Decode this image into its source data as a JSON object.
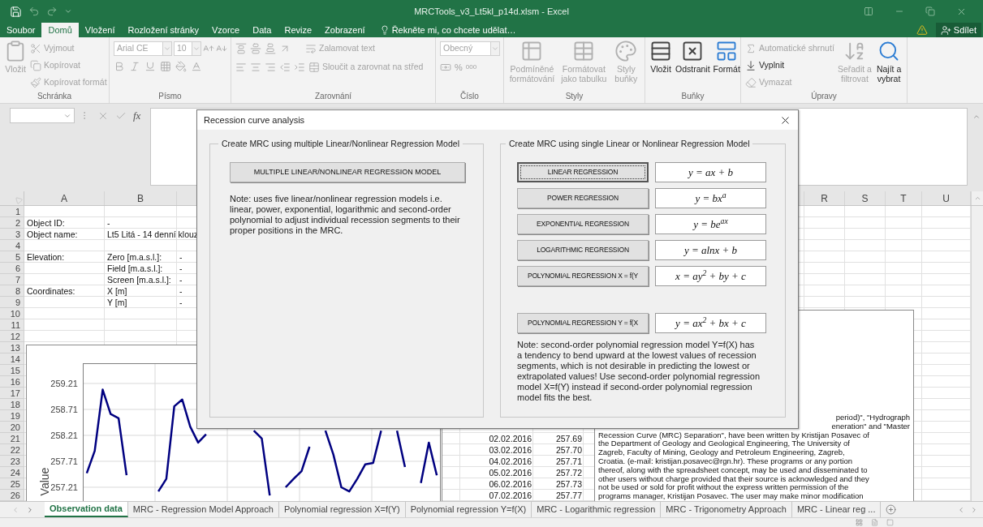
{
  "window": {
    "title": "MRCTools_v3_Lt5kl_p14d.xlsm - Excel"
  },
  "menu_tabs": [
    {
      "label": "Soubor",
      "selected": false
    },
    {
      "label": "Domů",
      "selected": true
    },
    {
      "label": "Vložení",
      "selected": false
    },
    {
      "label": "Rozložení stránky",
      "selected": false
    },
    {
      "label": "Vzorce",
      "selected": false
    },
    {
      "label": "Data",
      "selected": false
    },
    {
      "label": "Revize",
      "selected": false
    },
    {
      "label": "Zobrazení",
      "selected": false
    }
  ],
  "tell_me": {
    "placeholder": "Řekněte mi, co chcete udělat…"
  },
  "share_button": "Sdílet",
  "ribbon_groups": [
    {
      "kind": "clipboard",
      "label": "Schránka",
      "items": [
        {
          "kind": "large",
          "label": "Vložit",
          "disabled": true
        },
        {
          "kind": "small",
          "label": "Vyjmout",
          "disabled": true
        },
        {
          "kind": "small",
          "label": "Kopírovat",
          "disabled": true
        },
        {
          "kind": "small",
          "label": "Kopírovat formát",
          "disabled": true
        }
      ]
    },
    {
      "kind": "font",
      "label": "Písmo",
      "items": [
        {
          "kind": "combo",
          "label": "Arial CE",
          "disabled": true
        },
        {
          "kind": "combo",
          "label": "10",
          "disabled": true
        }
      ]
    },
    {
      "kind": "alignment",
      "label": "Zarovnání",
      "items": [
        {
          "kind": "small",
          "label": "Zalamovat text",
          "disabled": true
        },
        {
          "kind": "small",
          "label": "Sloučit a zarovnat na střed",
          "disabled": true
        }
      ]
    },
    {
      "kind": "number",
      "label": "Číslo",
      "items": [
        {
          "kind": "combo",
          "label": "Obecný",
          "disabled": true
        },
        {
          "kind": "glyph",
          "label": "%",
          "disabled": true
        },
        {
          "kind": "glyph",
          "label": "000",
          "disabled": true
        }
      ]
    },
    {
      "kind": "styles",
      "label": "Styly",
      "items": [
        {
          "kind": "large",
          "label": "Podmíněné formátování",
          "disabled": true
        },
        {
          "kind": "large",
          "label": "Formátovat jako tabulku",
          "disabled": true
        },
        {
          "kind": "large",
          "label": "Styly buňky",
          "disabled": true
        }
      ]
    },
    {
      "kind": "cells",
      "label": "Buňky",
      "items": [
        {
          "kind": "large",
          "label": "Vložit",
          "disabled": false
        },
        {
          "kind": "large",
          "label": "Odstranit",
          "disabled": false
        },
        {
          "kind": "large",
          "label": "Formát",
          "disabled": false
        }
      ]
    },
    {
      "kind": "editing",
      "label": "Úpravy",
      "items": [
        {
          "kind": "small",
          "label": "Automatické shrnutí",
          "disabled": true
        },
        {
          "kind": "small",
          "label": "Vyplnit",
          "disabled": false
        },
        {
          "kind": "small",
          "label": "Vymazat",
          "disabled": true
        },
        {
          "kind": "large",
          "label": "Seřadit a filtrovat",
          "disabled": true
        },
        {
          "kind": "large",
          "label": "Najít a vybrat",
          "disabled": false
        }
      ]
    }
  ],
  "formula_bar": {
    "function_label": "fx"
  },
  "column_headers_left": [
    "A",
    "B"
  ],
  "column_headers_right": [
    "R",
    "S",
    "T",
    "U"
  ],
  "sheet_rows": [
    {
      "number": "1"
    },
    {
      "number": "2",
      "column_a": "Object ID:",
      "column_b": "-"
    },
    {
      "number": "3",
      "column_a": "Object name:",
      "column_b": "Lt5 Litá - 14 denní klouz"
    },
    {
      "number": "4"
    },
    {
      "number": "5",
      "column_a": "Elevation:",
      "column_b": "Zero [m.a.s.l.]:",
      "column_c": "-"
    },
    {
      "number": "6",
      "column_b": "Field [m.a.s.l.]:",
      "column_c": "-"
    },
    {
      "number": "7",
      "column_b": "Screen [m.a.s.l.]:",
      "column_c": "-"
    },
    {
      "number": "8",
      "column_a": "Coordinates:",
      "column_b": "X [m]",
      "column_c": "-"
    },
    {
      "number": "9",
      "column_b": "Y [m]",
      "column_c": "-"
    },
    {
      "number": "10"
    },
    {
      "number": "11"
    },
    {
      "number": "12"
    },
    {
      "number": "13"
    },
    {
      "number": "14"
    },
    {
      "number": "15"
    },
    {
      "number": "16"
    },
    {
      "number": "17"
    },
    {
      "number": "18"
    },
    {
      "number": "19"
    },
    {
      "number": "20"
    },
    {
      "number": "21",
      "column_g": "02.02.2016",
      "column_h": "257.69"
    },
    {
      "number": "22",
      "column_g": "03.02.2016",
      "column_h": "257.70"
    },
    {
      "number": "23",
      "column_g": "04.02.2016",
      "column_h": "257.71"
    },
    {
      "number": "24",
      "column_g": "05.02.2016",
      "column_h": "257.72"
    },
    {
      "number": "25",
      "column_g": "06.02.2016",
      "column_h": "257.73"
    },
    {
      "number": "26",
      "column_g": "07.02.2016",
      "column_h": "257.77"
    }
  ],
  "chart": {
    "chart_data": {
      "type": "line",
      "ylabel": "Value",
      "grid": true,
      "ylim": [
        256.6,
        259.6
      ],
      "yticks": [
        257.21,
        257.71,
        258.21,
        258.71,
        259.21
      ],
      "series": [
        {
          "color": "#000080",
          "values": [
            257.48,
            257.91,
            259.09,
            258.62,
            258.54,
            257.44,
            null,
            null,
            null,
            257.13,
            257.37,
            258.77,
            258.9,
            258.38,
            258.07,
            258.23,
            null,
            null,
            null,
            null,
            null,
            258.3,
            258.15,
            257.05,
            null,
            257.21,
            257.37,
            257.52,
            257.99,
            null,
            258.3,
            257.84,
            257.21,
            257.13,
            257.37,
            257.65,
            257.68,
            258.3,
            null,
            258.3,
            257.6,
            null,
            257.29,
            258.07,
            257.44
          ]
        }
      ]
    }
  },
  "text_box": {
    "lines": [
      {
        "kind": "fragment",
        "text": "period)\", \"Hydrograph"
      },
      {
        "kind": "fragment",
        "text": "eneration\" and \"Master"
      },
      {
        "kind": "line",
        "text": "Recession Curve (MRC) Separation\", have been written by Kristijan Posavec of"
      },
      {
        "kind": "line",
        "text": "the Department of Geology and Geological Engineering, The University of"
      },
      {
        "kind": "line",
        "text": "Zagreb, Faculty of Mining, Geology and Petroleum Engineering, Zagreb,"
      },
      {
        "kind": "line",
        "text": "Croatia. (e-mail: kristijan.posavec@rgn.hr). These programs or any portion"
      },
      {
        "kind": "line",
        "text": "thereof, along with the spreadsheet concept, may be used and disseminated to"
      },
      {
        "kind": "line",
        "text": "other users without charge provided that their source is acknowledged and they"
      },
      {
        "kind": "line",
        "text": "not be used or sold for profit without the express written permission of the"
      },
      {
        "kind": "line",
        "text": "programs manager, Kristijan Posavec. The user may make minor modification"
      }
    ]
  },
  "dialog": {
    "title": "Recession curve analysis",
    "left_group": {
      "legend": "Create MRC using multiple Linear/Nonlinear Regression Model",
      "button": "MULTIPLE LINEAR/NONLINEAR REGRESSION MODEL",
      "note": "Note: uses five linear/nonlinear regression models i.e. linear, power, exponential, logarithmic and second-order polynomial to adjust individual recession segments to their proper positions in the MRC."
    },
    "right_group": {
      "legend": "Create MRC using single Linear or Nonlinear Regression Model",
      "models": [
        {
          "button": "LINEAR REGRESSION",
          "formula": "y = ax + b",
          "focused": true
        },
        {
          "button": "POWER REGRESSION",
          "formula": "y = bx$^{a}$",
          "focused": false
        },
        {
          "button": "EXPONENTIAL REGRESSION",
          "formula": "y = be$^{ax}$",
          "focused": false
        },
        {
          "button": "LOGARITHMIC REGRESSION",
          "formula": "y = alnx + b",
          "focused": false
        },
        {
          "button": "POLYNOMIAL REGRESSION X = f(Y",
          "formula": "x = ay$^{2}$ + by + c",
          "focused": false
        }
      ],
      "models_below": [
        {
          "button": "POLYNOMIAL REGRESSION Y = f(X",
          "formula": "y = ax$^{2}$ + bx + c",
          "focused": false
        }
      ],
      "note": "Note: second-order polynomial regression model Y=f(X) has a tendency to bend upward at the lowest values of recession segments, which is not desirable in predicting the lowest or extrapolated values! Use second-order polynomial regression model X=f(Y) instead if second-order polynomial regression model fits the best."
    }
  },
  "sheet_tabs": [
    {
      "label": "Observation data",
      "selected": true
    },
    {
      "label": "MRC - Regression Model Approach",
      "selected": false
    },
    {
      "label": "Polynomial regression X=f(Y)",
      "selected": false
    },
    {
      "label": "Polynomial regression Y=f(X)",
      "selected": false
    },
    {
      "label": "MRC - Logarithmic regression",
      "selected": false
    },
    {
      "label": "MRC - Trigonometry Approach",
      "selected": false
    },
    {
      "label": "MRC - Linear reg ...",
      "selected": false
    }
  ]
}
